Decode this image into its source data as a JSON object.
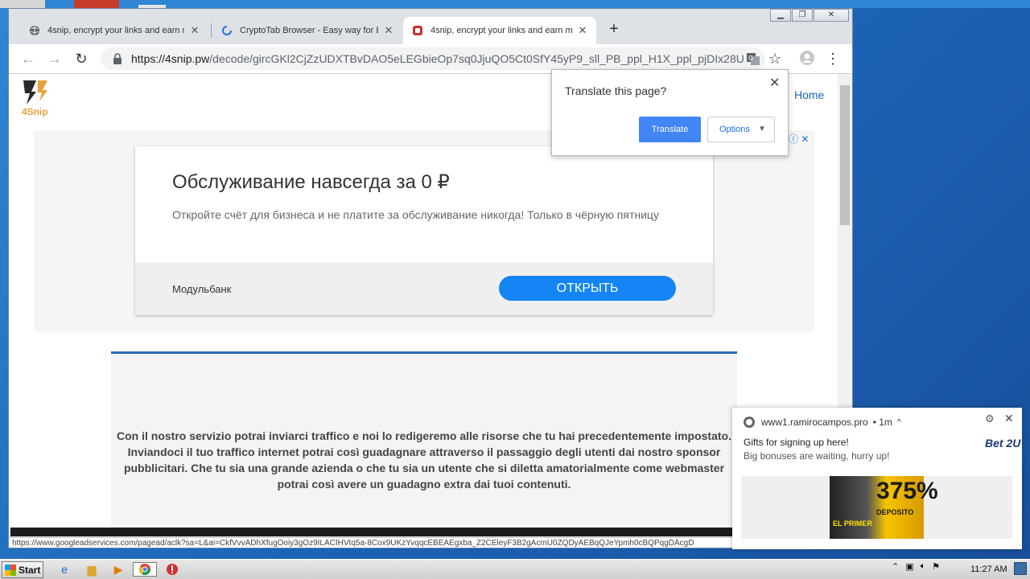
{
  "browser": {
    "tabs": [
      {
        "title": "4snip, encrypt your links and earn m",
        "icon": "globe-icon",
        "active": false
      },
      {
        "title": "CryptoTab Browser - Easy way for Bi",
        "icon": "loading-icon",
        "active": false
      },
      {
        "title": "4snip, encrypt your links and earn m",
        "icon": "4snip-favicon-icon",
        "active": true
      }
    ],
    "close_glyph": "✕",
    "new_tab_glyph": "+",
    "url_host": "https://4snip.pw",
    "url_path": "/decode/gircGKl2CjZzUDXTBvDAO5eLEGbieOp7sq0JjuQO5Ct0SfY45yP9_sll_PB_ppl_H1X_ppl_pjDIx28U...",
    "status_url": "https://www.googleadservices.com/pagead/aclk?sa=L&ai=CkfVvvADhXfugOoiy3gOz9ILACIHVtq5a-8Cox9UKzYvqqcEBEAEgxba_Z2CEleyF3B2gAcmU0ZQDyAEBqQJeYpmh0cBQPqgDAcgD"
  },
  "site": {
    "logo_text": "4Snip",
    "home_link": "Home"
  },
  "ad": {
    "title": "Обслуживание навсегда за 0 ₽",
    "description": "Откройте счёт для бизнеса и не платите за обслуживание никогда! Только в чёрную пятницу",
    "brand": "Модульбанк",
    "cta": "ОТКРЫТЬ",
    "badge": "ⓘ ✕"
  },
  "content": {
    "paragraph": "Con il nostro servizio potrai inviarci traffico e noi lo redigeremo alle risorse che tu hai precedentemente impostato. Inviandoci il tuo traffico internet potrai così guadagnare attraverso il passaggio degli utenti dai nostro sponsor pubblicitari. Che tu sia una grande azienda o che tu sia un utente che si diletta amatorialmente come webmaster potrai così avere un guadagno extra dai tuoi contenuti."
  },
  "translate_popup": {
    "title": "Translate this page?",
    "translate_label": "Translate",
    "options_label": "Options",
    "close_glyph": "✕"
  },
  "notification": {
    "site": "www1.ramirocampos.pro",
    "time": "• 1m",
    "title": "Gifts for signing up here!",
    "body": "Big bonuses are waiting, hurry up!",
    "brand_logo": "Bet 2U",
    "image_pct": "375%",
    "image_sub": "DEPOSITO",
    "image_left": "EL PRIMER"
  },
  "taskbar": {
    "start_label": "Start",
    "clock": "11:27 AM"
  },
  "colors": {
    "accent_blue": "#4285f4",
    "cta_blue": "#1584f5",
    "link_blue": "#1565c0"
  }
}
